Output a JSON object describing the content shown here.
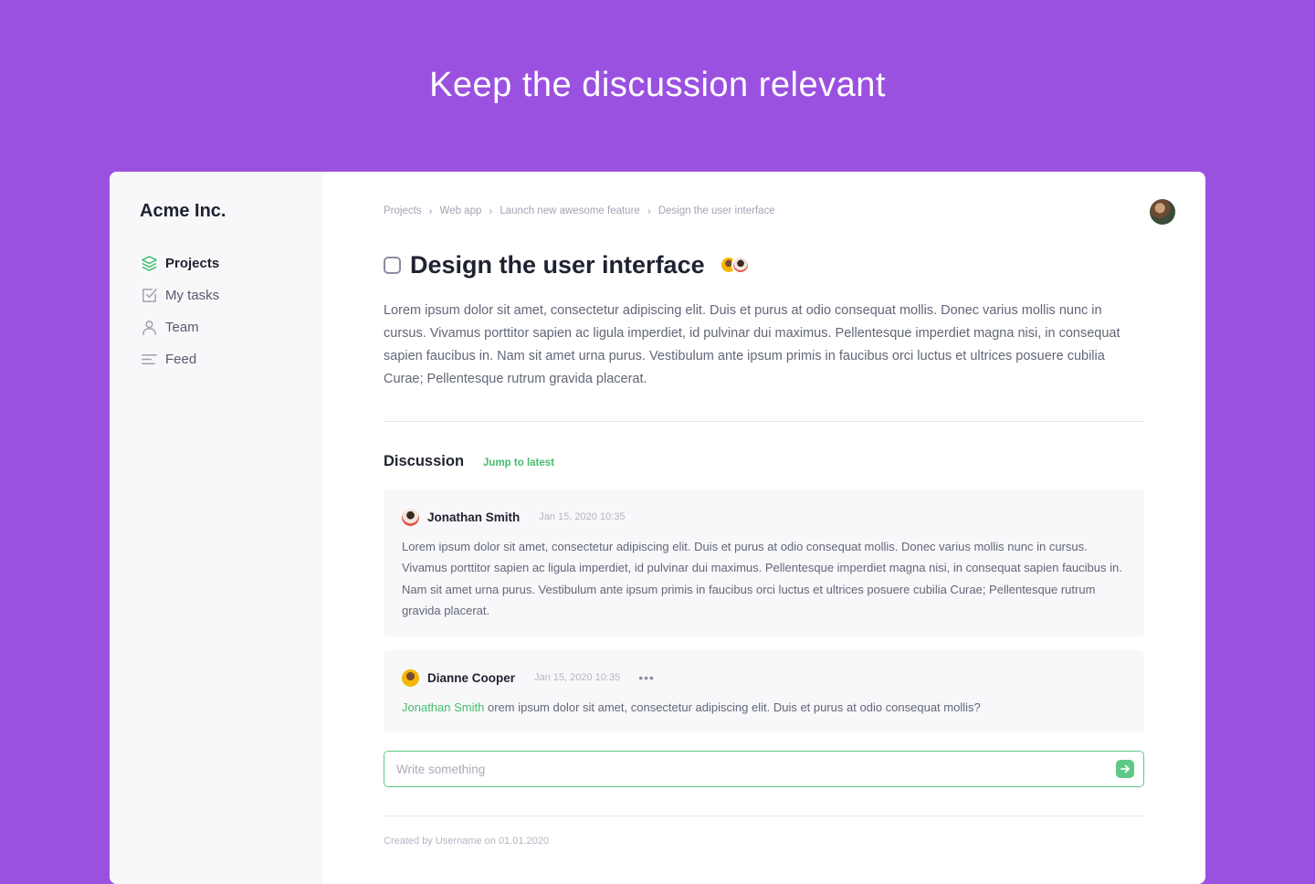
{
  "headline": "Keep the discussion relevant",
  "sidebar": {
    "brand": "Acme Inc.",
    "items": [
      {
        "label": "Projects",
        "icon": "layers-icon",
        "active": true
      },
      {
        "label": "My tasks",
        "icon": "checkbox-icon"
      },
      {
        "label": "Team",
        "icon": "user-icon"
      },
      {
        "label": "Feed",
        "icon": "feed-lines-icon"
      }
    ]
  },
  "breadcrumb": [
    "Projects",
    "Web app",
    "Launch new awesome feature",
    "Design the user interface"
  ],
  "task": {
    "title": "Design the user interface",
    "description": "Lorem ipsum dolor sit amet, consectetur adipiscing elit. Duis et purus at odio consequat mollis. Donec varius mollis nunc in cursus. Vivamus porttitor sapien ac ligula imperdiet, id pulvinar dui maximus. Pellentesque imperdiet magna nisi, in consequat sapien faucibus in. Nam sit amet urna purus. Vestibulum ante ipsum primis in faucibus orci luctus et ultrices posuere cubilia Curae; Pellentesque rutrum gravida placerat."
  },
  "discussion": {
    "title": "Discussion",
    "jump_label": "Jump to latest",
    "comments": [
      {
        "author": "Jonathan Smith",
        "time": "Jan 15, 2020 10:35",
        "body": "Lorem ipsum dolor sit amet, consectetur adipiscing elit. Duis et purus at odio consequat mollis. Donec varius mollis nunc in cursus. Vivamus porttitor sapien ac ligula imperdiet, id pulvinar dui maximus. Pellentesque imperdiet magna nisi, in consequat sapien faucibus in. Nam sit amet urna purus. Vestibulum ante ipsum primis in faucibus orci luctus et ultrices posuere cubilia Curae; Pellentesque rutrum gravida placerat."
      },
      {
        "author": "Dianne Cooper",
        "time": "Jan 15, 2020 10:35",
        "more": "•••",
        "mention": "Jonathan Smith",
        "body": "orem ipsum dolor sit amet, consectetur adipiscing elit. Duis et purus at odio consequat mollis?"
      }
    ],
    "composer_placeholder": "Write something"
  },
  "footer": "Created by Username on 01.01.2020",
  "colors": {
    "background": "#9b51e0",
    "accent": "#44bd6e",
    "sidebar": "#f8f8fa"
  }
}
